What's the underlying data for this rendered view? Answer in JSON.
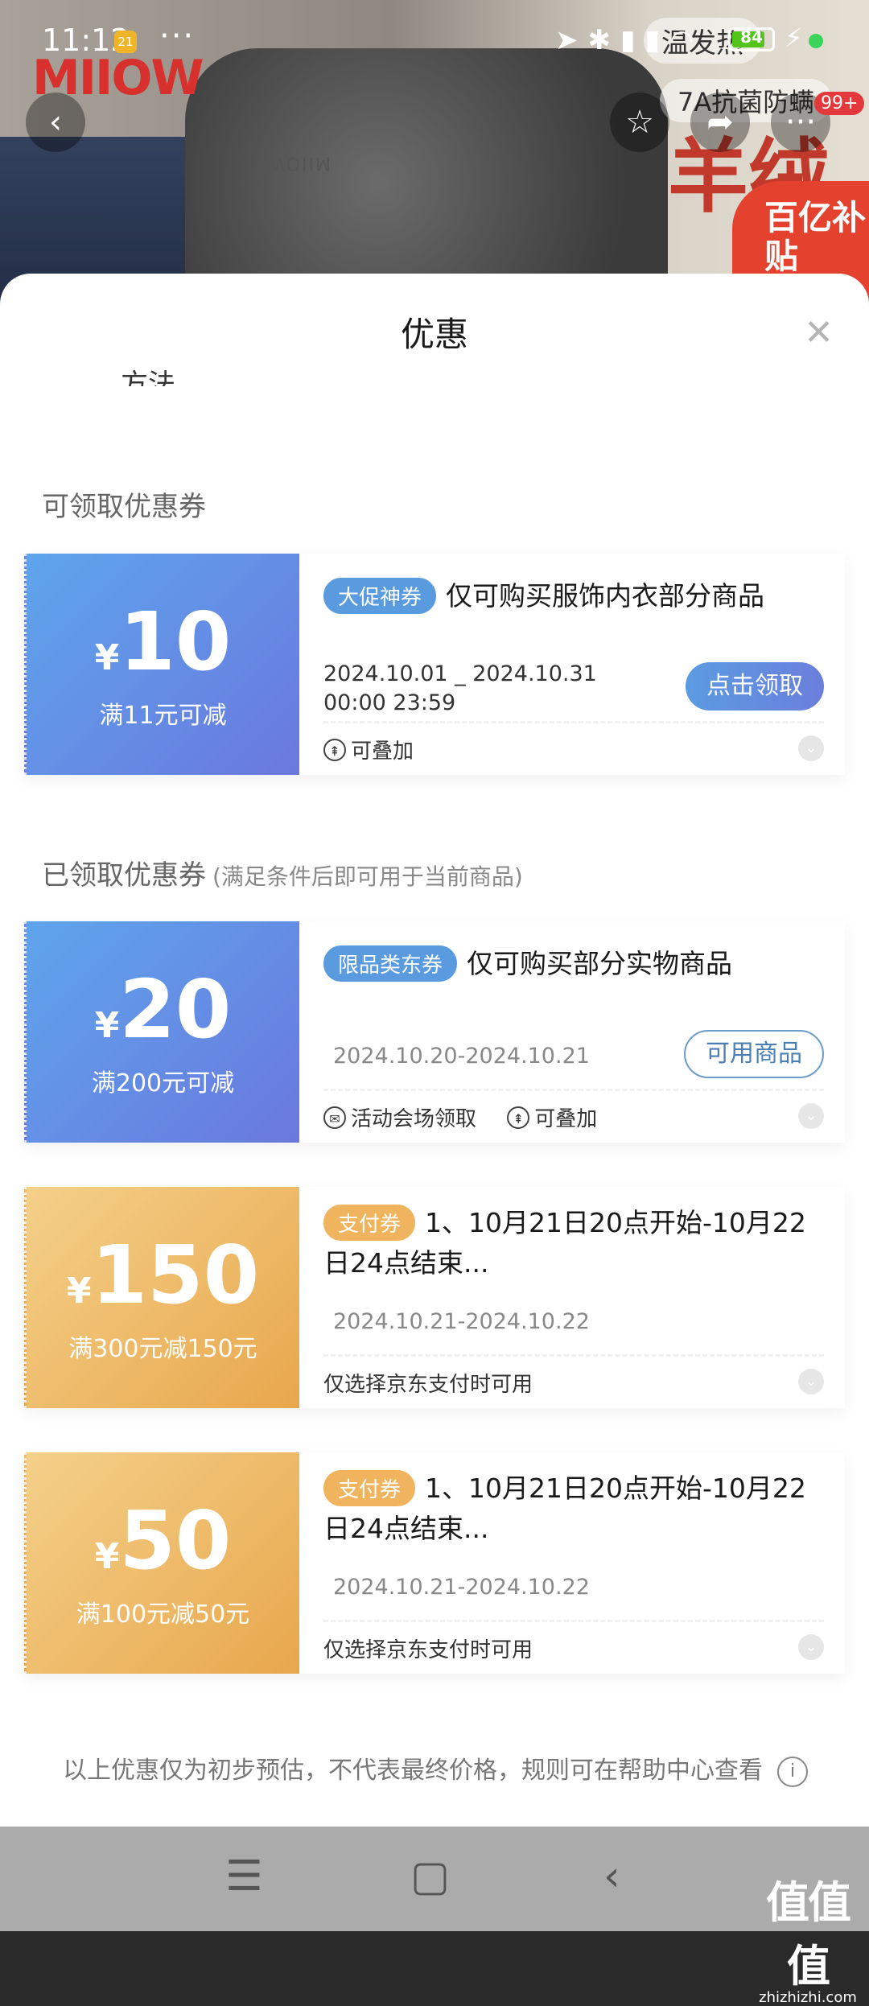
{
  "status_bar": {
    "time": "11:12",
    "notif_count": "21",
    "more": "···",
    "battery": "84",
    "battery_level": 0.84
  },
  "background": {
    "brand_logo": "MIIOW",
    "scarf_logo": "MIIOW",
    "tag1": "温发热",
    "tag2": "7A抗菌防螨",
    "big_text": "羊绒",
    "subsidy": "百亿补贴",
    "badge": "99+"
  },
  "sheet": {
    "title": "优惠",
    "cut_text": "方法",
    "section_available": "可领取优惠券",
    "section_claimed": "已领取优惠券",
    "section_claimed_sub": "(满足条件后即可用于当前商品)",
    "disclaimer": "以上优惠仅为初步预估，不代表最终价格，规则可在帮助中心查看"
  },
  "coupons": [
    {
      "symbol": "¥",
      "amount": "10",
      "condition": "满11元可减",
      "tag": "大促神券",
      "title": "仅可购买服饰内衣部分商品",
      "date": "2024.10.01 _ 2024.10.31\n00:00 23:59",
      "foot_items": [
        "可叠加"
      ],
      "action": "点击领取",
      "color": "#5ea5ec"
    },
    {
      "symbol": "¥",
      "amount": "20",
      "condition": "满200元可减",
      "tag": "限品类东券",
      "title": "仅可购买部分实物商品",
      "date": "2024.10.20-2024.10.21",
      "foot_items": [
        "活动会场领取",
        "可叠加"
      ],
      "action": "可用商品",
      "color": "#5ea5ec"
    },
    {
      "symbol": "¥",
      "amount": "150",
      "condition": "满300元减150元",
      "tag": "支付券",
      "title": "1、10月21日20点开始-10月22日24点结束...",
      "date": "2024.10.21-2024.10.22",
      "foot_items": [
        "仅选择京东支付时可用"
      ],
      "color": "#f4d08a"
    },
    {
      "symbol": "¥",
      "amount": "50",
      "condition": "满100元减50元",
      "tag": "支付券",
      "title": "1、10月21日20点开始-10月22日24点结束...",
      "date": "2024.10.21-2024.10.22",
      "foot_items": [
        "仅选择京东支付时可用"
      ],
      "color": "#f4d08a"
    }
  ],
  "watermark": {
    "big": "值值值",
    "small": "zhizhizhi.com"
  }
}
